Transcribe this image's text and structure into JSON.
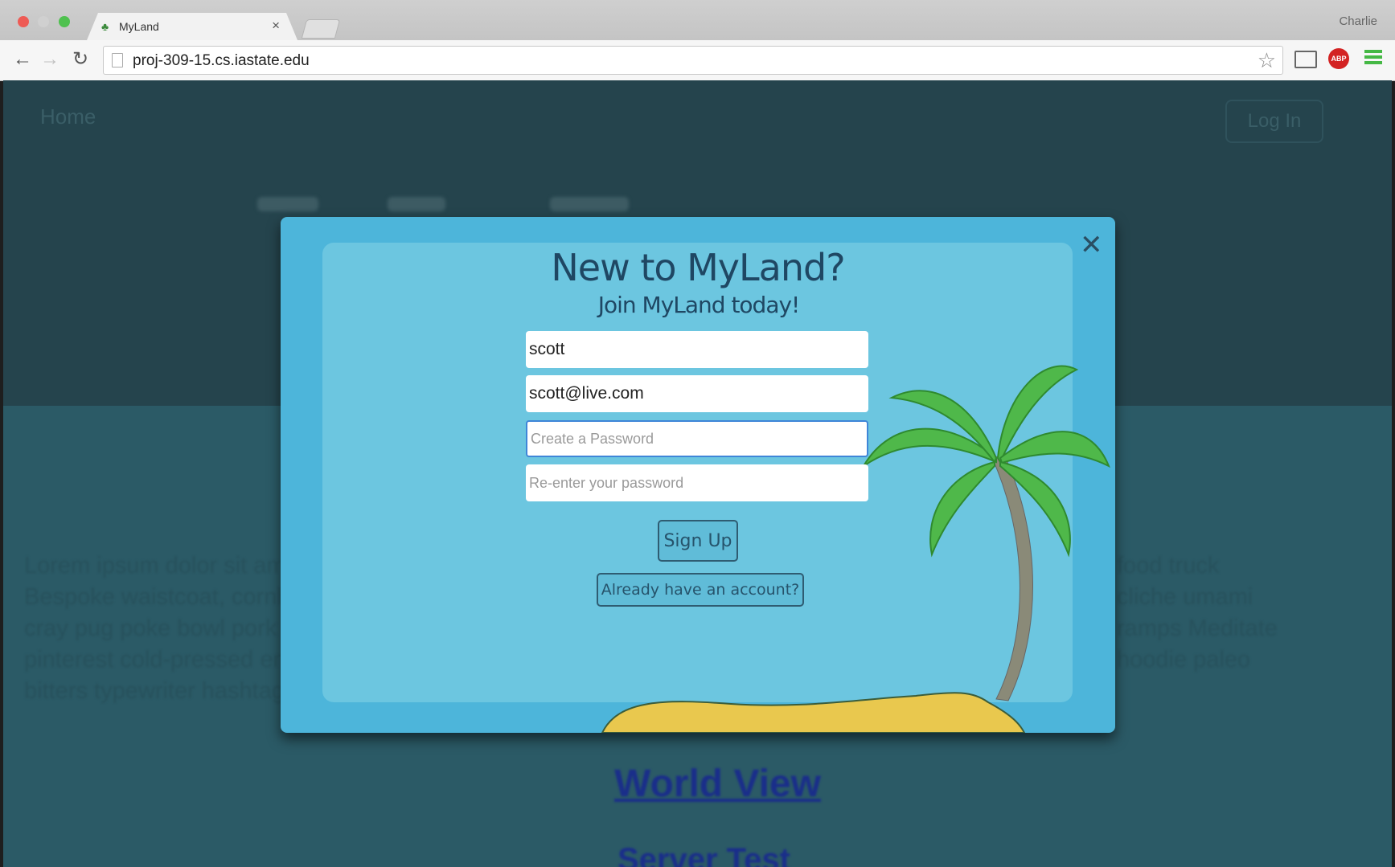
{
  "browser": {
    "tab_title": "MyLand",
    "tab_close": "×",
    "profile_name": "Charlie",
    "url": "proj-309-15.cs.iastate.edu",
    "abp_label": "ABP",
    "back_glyph": "←",
    "forward_glyph": "→",
    "reload_glyph": "↻",
    "star_glyph": "☆"
  },
  "page": {
    "nav_home": "Home",
    "nav_login": "Log In",
    "body_left_lines": [
      "Lorem ipsum dolor sit amet",
      "Bespoke waistcoat, cornhole",
      "cray pug poke bowl pork",
      "pinterest cold-pressed ennui",
      "bitters typewriter hashtag"
    ],
    "body_right_lines": [
      "food truck",
      "cliche umami",
      "ramps Meditate",
      "hoodie paleo",
      ""
    ],
    "world_view_link": "World View",
    "server_test_link": "Server Test"
  },
  "modal": {
    "title": "New to MyLand?",
    "subtitle": "Join MyLand today!",
    "close_glyph": "✕",
    "username_value": "scott",
    "email_value": "scott@live.com",
    "password_placeholder": "Create a Password",
    "password_confirm_placeholder": "Re-enter your password",
    "signup_label": "Sign Up",
    "have_account_label": "Already have an account?"
  },
  "colors": {
    "modal_bg": "#4db5da",
    "modal_inner": "#6cc6e0",
    "palm_leaf": "#4fb84a",
    "sand": "#e9c84e",
    "page_bg": "#25444d"
  },
  "icons": [
    "palm-favicon-icon",
    "back-icon",
    "forward-icon",
    "reload-icon",
    "page-icon",
    "star-icon",
    "cast-icon",
    "abp-icon",
    "menu-icon",
    "close-icon"
  ]
}
